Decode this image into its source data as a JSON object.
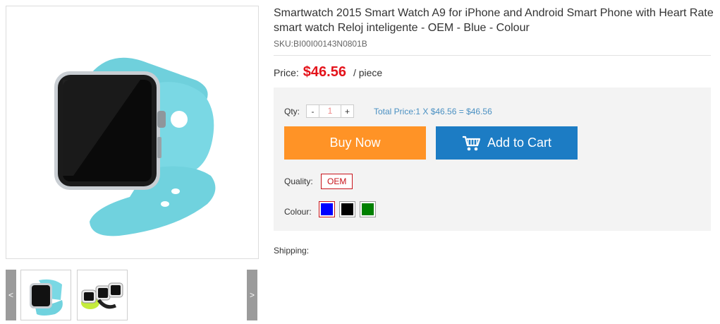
{
  "product": {
    "title": "Smartwatch 2015 Smart Watch A9 for iPhone and Android Smart Phone with Heart Rate smart watch Reloj inteligente - OEM - Blue - Colour",
    "sku": "SKU:BI00I00143N0801B",
    "price_label": "Price:",
    "price": "$46.56",
    "price_unit": "/ piece"
  },
  "gallery": {
    "prev_label": "<",
    "next_label": ">",
    "band_color": "#79d6e2"
  },
  "purchase": {
    "qty_label": "Qty:",
    "qty_minus": "-",
    "qty_value": "1",
    "qty_plus": "+",
    "total_text": "Total Price:1 X $46.56 = $46.56",
    "buy_now_label": "Buy Now",
    "add_to_cart_label": "Add to Cart",
    "buy_color": "#ff9326",
    "cart_color": "#1c7cc4"
  },
  "options": {
    "quality_label": "Quality:",
    "quality_value": "OEM",
    "colour_label": "Colour:",
    "colours": [
      "#0000ff",
      "#000000",
      "#008000"
    ]
  },
  "shipping": {
    "label": "Shipping:"
  }
}
